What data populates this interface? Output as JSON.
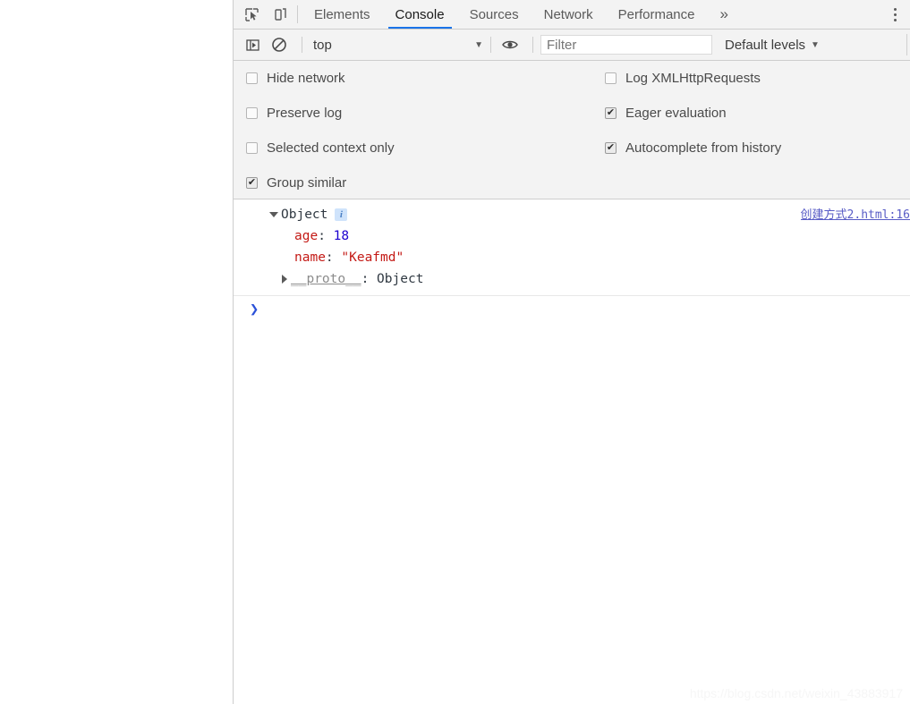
{
  "window": {
    "page_background": "#ffffff",
    "devtools_background": "#f3f3f3",
    "accent_color": "#1a73e8"
  },
  "tabbar": {
    "icons": [
      {
        "name": "inspect-element-icon",
        "label": "Inspect element"
      },
      {
        "name": "device-toolbar-icon",
        "label": "Toggle device toolbar"
      }
    ],
    "tabs": [
      {
        "label": "Elements",
        "active": false
      },
      {
        "label": "Console",
        "active": true
      },
      {
        "label": "Sources",
        "active": false
      },
      {
        "label": "Network",
        "active": false
      },
      {
        "label": "Performance",
        "active": false
      }
    ],
    "more_tabs_label": "»",
    "kebab_label": "Customize and control DevTools"
  },
  "console_toolbar": {
    "sidebar_toggle_label": "Show console sidebar",
    "clear_console_label": "Clear console",
    "context_selector": {
      "value": "top",
      "caret": "▼"
    },
    "live_expression_label": "Create live expression",
    "filter": {
      "placeholder": "Filter",
      "value": ""
    },
    "levels": {
      "label": "Default levels",
      "caret": "▼"
    }
  },
  "settings": {
    "left_column": [
      {
        "label": "Hide network",
        "checked": false
      },
      {
        "label": "Preserve log",
        "checked": false
      },
      {
        "label": "Selected context only",
        "checked": false
      },
      {
        "label": "Group similar",
        "checked": true
      }
    ],
    "right_column": [
      {
        "label": "Log XMLHttpRequests",
        "checked": false
      },
      {
        "label": "Eager evaluation",
        "checked": true
      },
      {
        "label": "Autocomplete from history",
        "checked": true
      }
    ]
  },
  "console_output": {
    "entries": [
      {
        "expanded": true,
        "root_label": "Object",
        "info_badge": "i",
        "source_link": "创建方式2.html:16",
        "properties": [
          {
            "key": "age",
            "separator": ": ",
            "value": "18",
            "value_type": "number"
          },
          {
            "key": "name",
            "separator": ": ",
            "value": "\"Keafmd\"",
            "value_type": "string"
          },
          {
            "key": "__proto__",
            "separator": ": ",
            "value": "Object",
            "value_type": "plain",
            "expandable": true
          }
        ]
      }
    ],
    "prompt_caret": "❯"
  },
  "watermark": {
    "text": "https://blog.csdn.net/weixin_43883917"
  }
}
